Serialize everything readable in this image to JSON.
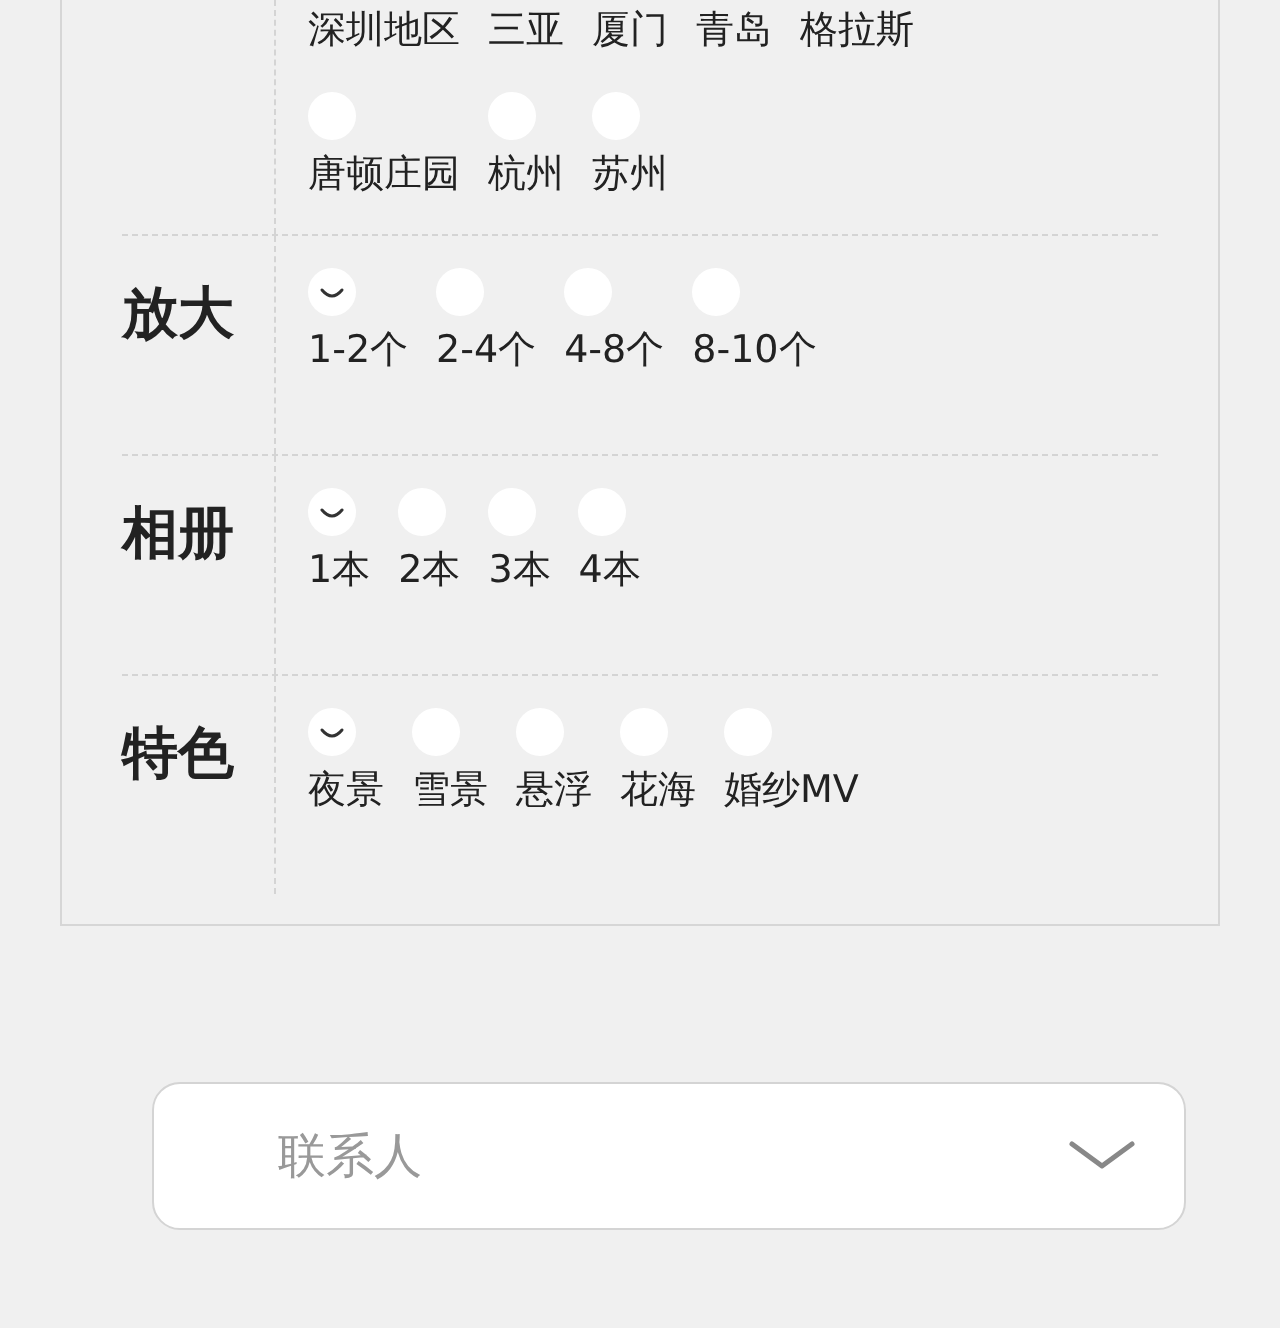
{
  "sections": [
    {
      "kind": "cut",
      "cut_labels": [
        "深圳地区",
        "三亚",
        "厦门",
        "青岛",
        "格拉斯"
      ],
      "options": [
        {
          "label": "唐顿庄园",
          "selected": false
        },
        {
          "label": "杭州",
          "selected": false
        },
        {
          "label": "苏州",
          "selected": false
        }
      ]
    },
    {
      "kind": "full",
      "label": "放大",
      "options": [
        {
          "label": "1-2个",
          "selected": true
        },
        {
          "label": "2-4个",
          "selected": false
        },
        {
          "label": "4-8个",
          "selected": false
        },
        {
          "label": "8-10个",
          "selected": false
        }
      ]
    },
    {
      "kind": "full",
      "label": "相册",
      "options": [
        {
          "label": "1本",
          "selected": true
        },
        {
          "label": "2本",
          "selected": false
        },
        {
          "label": "3本",
          "selected": false
        },
        {
          "label": "4本",
          "selected": false
        }
      ]
    },
    {
      "kind": "full",
      "label": "特色",
      "options": [
        {
          "label": "夜景",
          "selected": true
        },
        {
          "label": "雪景",
          "selected": false
        },
        {
          "label": "悬浮",
          "selected": false
        },
        {
          "label": "花海",
          "selected": false
        },
        {
          "label": "婚纱MV",
          "selected": false
        }
      ]
    }
  ],
  "contact_select": {
    "placeholder": "联系人"
  }
}
